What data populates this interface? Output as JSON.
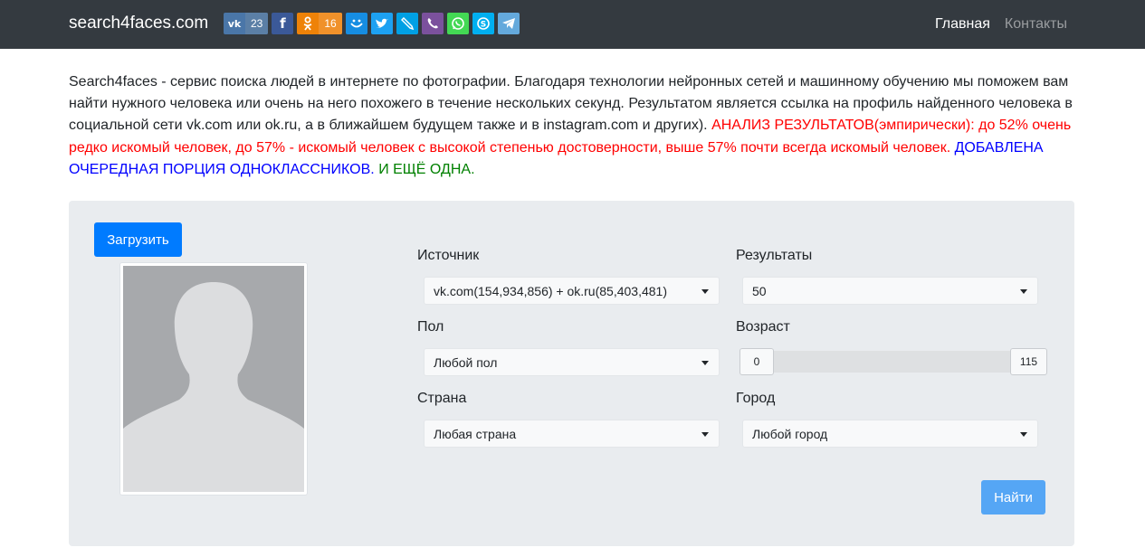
{
  "navbar": {
    "brand": "search4faces.com",
    "share": {
      "vk_count": "23",
      "ok_count": "16"
    },
    "links": [
      {
        "label": "Главная",
        "active": true
      },
      {
        "label": "Контакты",
        "active": false
      }
    ]
  },
  "intro": {
    "text": "Search4faces - сервис поиска людей в интернете по фотографии. Благодаря технологии нейронных сетей и машинному обучению мы поможем вам найти нужного человека или очень на него похожего в течение нескольких секунд. Результатом является ссылка на профиль найденного человека в социальной сети vk.com или ok.ru, а в ближайшем будущем также и в instagram.com и других). ",
    "red": "АНАЛИЗ РЕЗУЛЬТАТОВ(эмпирически): до 52% очень редко искомый человек, до 57% - искомый человек с высокой степенью достоверности, выше 57% почти всегда искомый человек.",
    "blue": "ДОБАВЛЕНА ОЧЕРЕДНАЯ ПОРЦИЯ ОДНОКЛАССНИКОВ.",
    "green": "И ЕЩЁ ОДНА."
  },
  "form": {
    "upload_label": "Загрузить",
    "source": {
      "label": "Источник",
      "value": "vk.com(154,934,856) + ok.ru(85,403,481)"
    },
    "results": {
      "label": "Результаты",
      "value": "50"
    },
    "gender": {
      "label": "Пол",
      "value": "Любой пол"
    },
    "age": {
      "label": "Возраст",
      "min": "0",
      "max": "115"
    },
    "country": {
      "label": "Страна",
      "value": "Любая страна"
    },
    "city": {
      "label": "Город",
      "value": "Любой город"
    },
    "find_label": "Найти"
  },
  "colors": {
    "navbar_bg": "#343a40",
    "primary": "#007bff",
    "panel_bg": "#e9ecef",
    "vk": "#4a76a8",
    "facebook": "#3b5998",
    "odnoklassniki": "#ee8208",
    "moimir": "#168de2",
    "twitter": "#1da1f2",
    "livejournal": "#00a0e4",
    "viber": "#7b519d",
    "whatsapp": "#43d854",
    "skype": "#00aff0",
    "telegram": "#64a9dc"
  },
  "icons": [
    "vk-icon",
    "facebook-icon",
    "odnoklassniki-icon",
    "moimir-icon",
    "twitter-icon",
    "livejournal-icon",
    "viber-icon",
    "whatsapp-icon",
    "skype-icon",
    "telegram-icon",
    "caret-down-icon",
    "avatar-silhouette"
  ]
}
